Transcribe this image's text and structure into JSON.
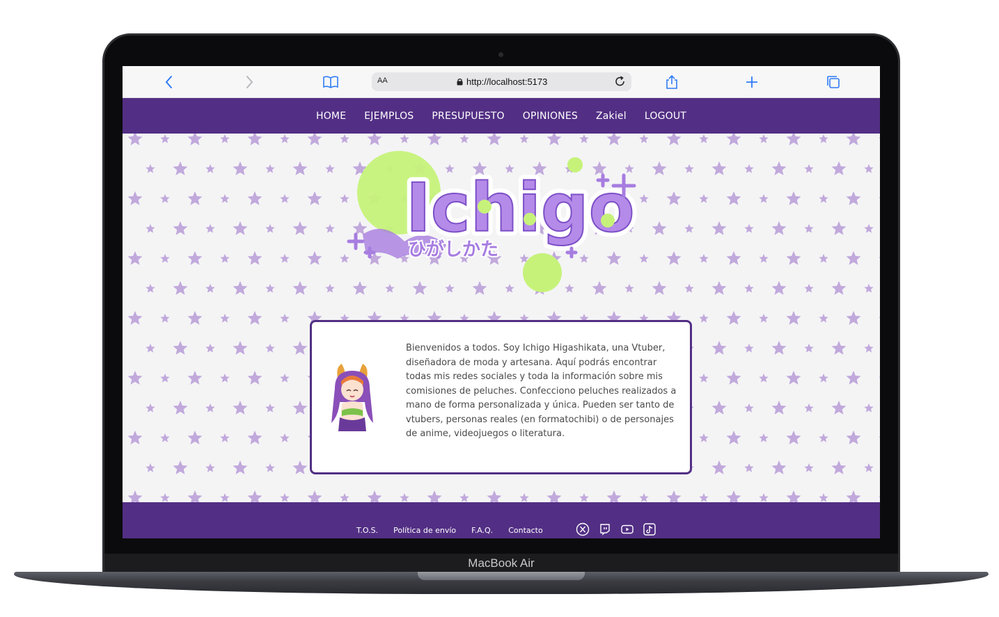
{
  "device": {
    "brand_label": "MacBook Air"
  },
  "browser": {
    "text_size_label": "AA",
    "url": "http://localhost:5173"
  },
  "nav": {
    "items": [
      "HOME",
      "EJEMPLOS",
      "PRESUPUESTO",
      "OPINIONES",
      "Zakiel",
      "LOGOUT"
    ]
  },
  "logo": {
    "title": "Ichigo",
    "subtitle": "ひがしかた"
  },
  "intro": {
    "text": "Bienvenidos a todos. Soy Ichigo Higashikata, una Vtuber, diseñadora de moda y artesana. Aquí podrás encontrar todas mis redes sociales y toda la información sobre mis comisiones de peluches. Confecciono peluches realizados a mano de forma personalizada y única. Pueden ser tanto de vtubers, personas reales (en formatochibi) o de personajes de anime, videojuegos o literatura."
  },
  "footer": {
    "links": [
      "T.O.S.",
      "Política de envío",
      "F.A.Q.",
      "Contacto"
    ],
    "social_icons": [
      "x-icon",
      "twitch-icon",
      "youtube-icon",
      "tiktok-icon"
    ]
  },
  "colors": {
    "brand_purple": "#522f84",
    "star_lilac": "#c1a9dc",
    "logo_green": "#c6f27a",
    "logo_purple": "#a77de0"
  }
}
